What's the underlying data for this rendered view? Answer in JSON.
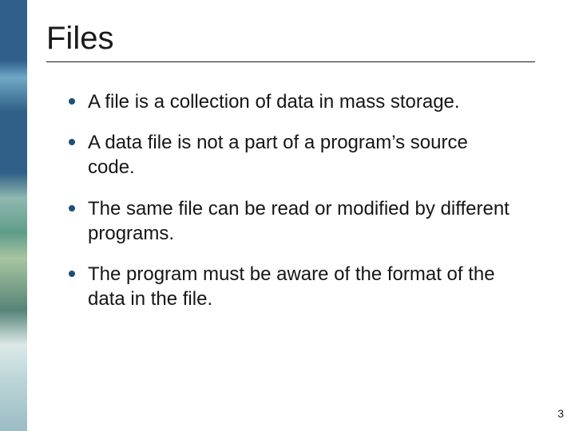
{
  "slide": {
    "title": "Files",
    "bullets": [
      "A file is a collection of data in mass storage.",
      "A data file is not a part of a program’s source code.",
      "The same file can be read or modified by different programs.",
      "The program must be aware of the format of the data in the file."
    ],
    "page_number": "3"
  },
  "colors": {
    "bullet_accent": "#1f4e79"
  }
}
